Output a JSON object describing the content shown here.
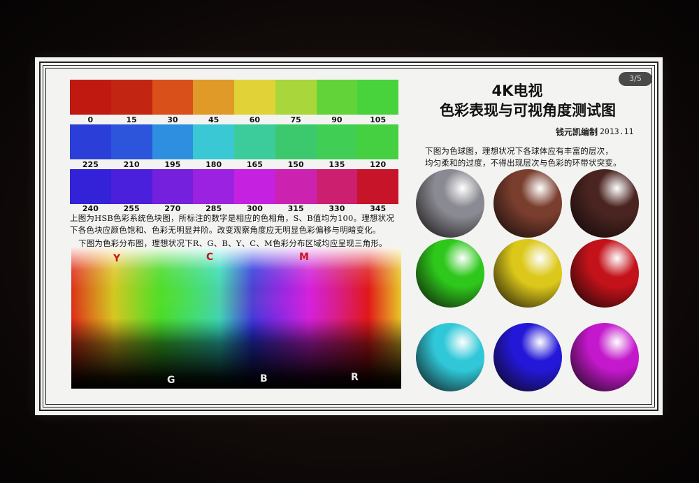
{
  "page_indicator": "3/5",
  "title": {
    "line1": "4K电视",
    "line2": "色彩表现与可视角度测试图"
  },
  "author": "钱元凯编制",
  "date": "2013.11",
  "hue_rows": [
    {
      "labels": [
        "0",
        "15",
        "30",
        "45",
        "60",
        "75",
        "90",
        "105"
      ],
      "colors": [
        "#c01a10",
        "#c22512",
        "#d9501a",
        "#e09a28",
        "#e1d238",
        "#a9d63a",
        "#62d43a",
        "#48d23c"
      ]
    },
    {
      "labels": [
        "225",
        "210",
        "195",
        "180",
        "165",
        "150",
        "135",
        "120"
      ],
      "colors": [
        "#2b3ed8",
        "#2c55dc",
        "#2e8fe0",
        "#3ac8d4",
        "#3ccc9c",
        "#3cc96e",
        "#40cf54",
        "#44d040"
      ]
    },
    {
      "labels": [
        "240",
        "255",
        "270",
        "285",
        "300",
        "315",
        "330",
        "345"
      ],
      "colors": [
        "#3322d8",
        "#4a20dc",
        "#7420dc",
        "#9a22e0",
        "#c422e0",
        "#cc22b0",
        "#cc1f70",
        "#c81428"
      ]
    }
  ],
  "hsb_description": [
    "上图为HSB色彩系统色块图，所标注的数字是相应的色相角，S、B值均为100。理想状况",
    "下各色块应颜色饱和、色彩无明显并阶。改变观察角度应无明显色彩偏移与明暗变化。"
  ],
  "distribution_description": "下图为色彩分布图，理想状况下R、G、B、Y、C、M色彩分布区域均应呈现三角形。",
  "distribution_labels": {
    "top": [
      {
        "text": "Y",
        "color": "#c8141a"
      },
      {
        "text": "C",
        "color": "#c8141a"
      },
      {
        "text": "M",
        "color": "#c8141a"
      }
    ],
    "bottom": [
      {
        "text": "G",
        "color": "#e8e8e8"
      },
      {
        "text": "B",
        "color": "#e8e8e8"
      },
      {
        "text": "R",
        "color": "#e8e8e8"
      }
    ]
  },
  "sphere_description": [
    "下图为色球图，理想状况下各球体应有丰富的层次，",
    "均匀柔和的过度，不得出现层次与色彩的环带状突变。"
  ],
  "spheres": [
    {
      "name": "gray",
      "color": "#8a8a92"
    },
    {
      "name": "brown",
      "color": "#7a3e2e"
    },
    {
      "name": "dark-brown",
      "color": "#4a2420"
    },
    {
      "name": "green",
      "color": "#2ec81c"
    },
    {
      "name": "yellow",
      "color": "#dcc81a"
    },
    {
      "name": "red",
      "color": "#c4121a"
    },
    {
      "name": "cyan",
      "color": "#30c8d8"
    },
    {
      "name": "blue",
      "color": "#2418d8"
    },
    {
      "name": "magenta",
      "color": "#c418cc"
    }
  ]
}
